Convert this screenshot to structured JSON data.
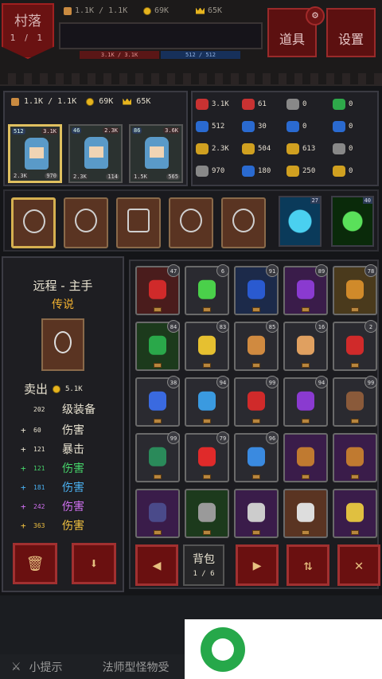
{
  "topbar": {
    "village_label": "村落",
    "village_progress": "1 / 1",
    "bag_count": "1.1K / 1.1K",
    "gold": "69K",
    "crowns": "65K",
    "hp_text": "3.1K / 3.1K",
    "mp_text": "512 / 512",
    "items_button": "道具",
    "settings_button": "设置"
  },
  "stats_left": {
    "bag": "1.1K / 1.1K",
    "gold": "69K",
    "crowns": "65K",
    "heroes": [
      {
        "level": "512",
        "power": "3.1K",
        "hp": "2.3K",
        "tag": "970"
      },
      {
        "level": "46",
        "power": "2.3K",
        "hp": "2.3K",
        "tag": "114"
      },
      {
        "level": "86",
        "power": "3.6K",
        "hp": "1.5K",
        "tag": "565"
      }
    ]
  },
  "stats_right": {
    "cells": [
      {
        "label": "3.1K",
        "color": "#c83232"
      },
      {
        "label": "61",
        "color": "#c83232"
      },
      {
        "label": "0",
        "color": "#888888"
      },
      {
        "label": "0",
        "color": "#2ea84a"
      },
      {
        "label": "512",
        "color": "#2a6ad0"
      },
      {
        "label": "30",
        "color": "#2a6ad0"
      },
      {
        "label": "0",
        "color": "#2a6ad0"
      },
      {
        "label": "0",
        "color": "#2a6ad0"
      },
      {
        "label": "2.3K",
        "color": "#d0a020"
      },
      {
        "label": "504",
        "color": "#d0a020"
      },
      {
        "label": "613",
        "color": "#d0a020"
      },
      {
        "label": "0",
        "color": "#888888"
      },
      {
        "label": "970",
        "color": "#888888"
      },
      {
        "label": "180",
        "color": "#2a6ad0"
      },
      {
        "label": "250",
        "color": "#d0a020"
      },
      {
        "label": "0",
        "color": "#d0a020"
      }
    ]
  },
  "skills": [
    {
      "level": "27"
    },
    {
      "level": "40"
    }
  ],
  "detail": {
    "title": "远程 - 主手",
    "rarity": "传说",
    "sell_label": "卖出",
    "sell_price": "5.1K",
    "level_num": "202",
    "level_label": "级装备",
    "attrs": [
      {
        "num": "60",
        "name": "伤害",
        "color": "#e8e2d0"
      },
      {
        "num": "121",
        "name": "暴击",
        "color": "#e8e2d0"
      },
      {
        "num": "121",
        "name": "伤害",
        "color": "#46d46a"
      },
      {
        "num": "181",
        "name": "伤害",
        "color": "#4ab0f0"
      },
      {
        "num": "242",
        "name": "伤害",
        "color": "#d070f0"
      },
      {
        "num": "363",
        "name": "伤害",
        "color": "#f0c040"
      }
    ]
  },
  "inventory": {
    "cells": [
      {
        "count": "47",
        "frame": "#4a1c1c",
        "item": "#d02a2a"
      },
      {
        "count": "6",
        "frame": "#2a2a30",
        "item": "#4ad04a"
      },
      {
        "count": "91",
        "frame": "#1c2a4a",
        "item": "#2a5ad0"
      },
      {
        "count": "89",
        "frame": "#3a1c4a",
        "item": "#8a3ad0"
      },
      {
        "count": "78",
        "frame": "#4a3a1c",
        "item": "#d08a2a"
      },
      {
        "count": "84",
        "frame": "#1c3a1c",
        "item": "#2aa84a"
      },
      {
        "count": "83",
        "frame": "#2a2a30",
        "item": "#e6c030"
      },
      {
        "count": "85",
        "frame": "#2a2a30",
        "item": "#d08a40"
      },
      {
        "count": "16",
        "frame": "#2a2a30",
        "item": "#e0a060"
      },
      {
        "count": "2",
        "frame": "#2a2a30",
        "item": "#d02a2a"
      },
      {
        "count": "38",
        "frame": "#2a2a30",
        "item": "#3a6ae0"
      },
      {
        "count": "94",
        "frame": "#2a2a30",
        "item": "#3a9ae0"
      },
      {
        "count": "99",
        "frame": "#2a2a30",
        "item": "#d02a2a"
      },
      {
        "count": "94",
        "frame": "#2a2a30",
        "item": "#8a3ad0"
      },
      {
        "count": "99",
        "frame": "#2a2a30",
        "item": "#8a5a3a"
      },
      {
        "count": "99",
        "frame": "#2a2a30",
        "item": "#2a8a5a"
      },
      {
        "count": "79",
        "frame": "#2a2a30",
        "item": "#e02a2a"
      },
      {
        "count": "96",
        "frame": "#2a2a30",
        "item": "#3a8ae0"
      },
      {
        "count": "",
        "frame": "#3a1c4a",
        "item": "#c07a30"
      },
      {
        "count": "",
        "frame": "#3a1c4a",
        "item": "#c07a30"
      },
      {
        "count": "",
        "frame": "#3a1c4a",
        "item": "#4a4a8a"
      },
      {
        "count": "",
        "frame": "#1c3a1c",
        "item": "#9a9a9a"
      },
      {
        "count": "",
        "frame": "#3a1c4a",
        "item": "#cccccc"
      },
      {
        "count": "",
        "frame": "#5a3422",
        "item": "#dddddd"
      },
      {
        "count": "",
        "frame": "#3a1c4a",
        "item": "#e0c040"
      }
    ],
    "bag_label": "背包",
    "page": "1 / 6"
  },
  "bottom": {
    "tip_label": "小提示",
    "tip_text": "法师型怪物受"
  }
}
